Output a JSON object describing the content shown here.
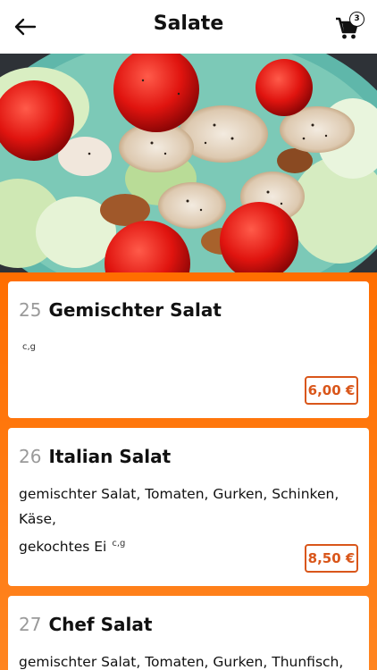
{
  "header": {
    "title": "Salate",
    "cart_count": "3",
    "back_icon": "arrow-left-icon",
    "cart_icon": "shopping-cart-icon"
  },
  "colors": {
    "accent": "#ff7a10",
    "price_border": "#d9561a",
    "card_bg": "#ffffff"
  },
  "items": [
    {
      "number": "25",
      "name": "Gemischter Salat",
      "description": "",
      "allergens": "c,g",
      "price": "6,00 €"
    },
    {
      "number": "26",
      "name": "Italian Salat",
      "description_line1": "gemischter Salat, Tomaten, Gurken, Schinken, Käse,",
      "description_line2": "gekochtes Ei",
      "allergens": "c,g",
      "price": "8,50 €"
    },
    {
      "number": "27",
      "name": "Chef Salat",
      "description_line1": "gemischter Salat, Tomaten, Gurken, Thunfisch,"
    }
  ]
}
